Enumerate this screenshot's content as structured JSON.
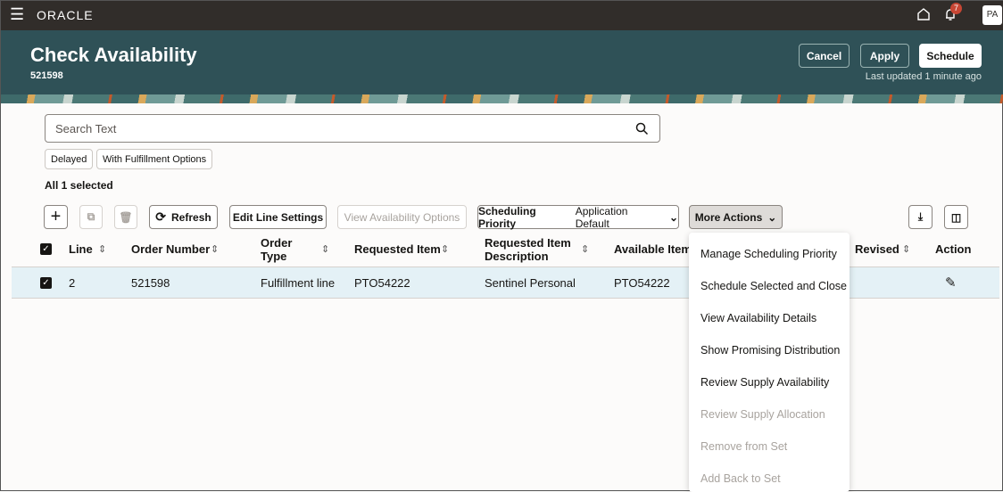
{
  "topbar": {
    "brand": "ORACLE",
    "notification_count": "7",
    "avatar": "PA"
  },
  "header": {
    "title": "Check Availability",
    "subtitle": "521598",
    "cancel": "Cancel",
    "apply": "Apply",
    "schedule": "Schedule",
    "last_updated": "Last updated 1 minute ago"
  },
  "search": {
    "placeholder": "Search Text"
  },
  "filters": [
    "Delayed",
    "With Fulfillment Options"
  ],
  "selection": "All 1 selected",
  "toolbar": {
    "refresh": "Refresh",
    "edit_line_settings": "Edit Line Settings",
    "view_availability_options": "View Availability Options",
    "priority_label": "Scheduling Priority",
    "priority_value": "Application Default",
    "more_actions": "More Actions"
  },
  "table": {
    "headers": {
      "line": "Line",
      "order_number": "Order Number",
      "order_type_1": "Order",
      "order_type_2": "Type",
      "requested_item": "Requested Item",
      "req_desc_1": "Requested Item",
      "req_desc_2": "Description",
      "available_item": "Available Item",
      "revised": "Revised",
      "action": "Action"
    },
    "rows": [
      {
        "line": "2",
        "order_number": "521598",
        "order_type": "Fulfillment line",
        "requested_item": "PTO54222",
        "description": "Sentinel Personal",
        "available_item": "PTO54222"
      }
    ]
  },
  "menu": [
    {
      "label": "Manage Scheduling Priority",
      "enabled": true
    },
    {
      "label": "Schedule Selected and Close",
      "enabled": true
    },
    {
      "label": "View Availability Details",
      "enabled": true
    },
    {
      "label": "Show Promising Distribution",
      "enabled": true
    },
    {
      "label": "Review Supply Availability",
      "enabled": true
    },
    {
      "label": "Review Supply Allocation",
      "enabled": false
    },
    {
      "label": "Remove from Set",
      "enabled": false
    },
    {
      "label": "Add Back to Set",
      "enabled": false
    }
  ]
}
